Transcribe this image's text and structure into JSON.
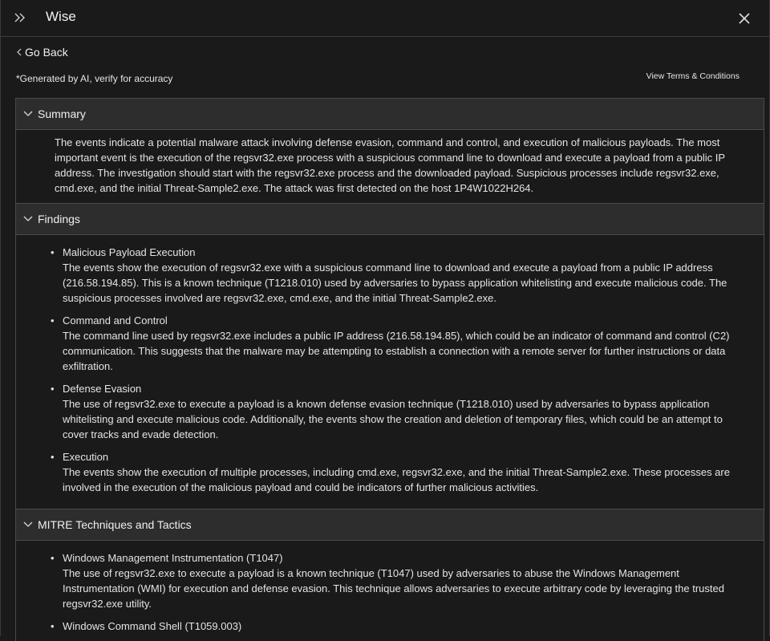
{
  "header": {
    "title": "Wise"
  },
  "nav": {
    "back_label": "Go Back"
  },
  "disclaimer": "*Generated by AI, verify for accuracy",
  "terms_link": "View Terms & Conditions",
  "sections": {
    "summary": {
      "title": "Summary",
      "text": "The events indicate a potential malware attack involving defense evasion, command and control, and execution of malicious payloads. The most important event is the execution of the regsvr32.exe process with a suspicious command line to download and execute a payload from a public IP address. The investigation should start with the regsvr32.exe process and the downloaded payload. Suspicious processes include regsvr32.exe, cmd.exe, and the initial Threat-Sample2.exe. The attack was first detected on the host 1P4W1022H264."
    },
    "findings": {
      "title": "Findings",
      "items": [
        {
          "heading": "Malicious Payload Execution",
          "text": "The events show the execution of regsvr32.exe with a suspicious command line to download and execute a payload from a public IP address (216.58.194.85). This is a known technique (T1218.010) used by adversaries to bypass application whitelisting and execute malicious code. The suspicious processes involved are regsvr32.exe, cmd.exe, and the initial Threat-Sample2.exe."
        },
        {
          "heading": "Command and Control",
          "text": "The command line used by regsvr32.exe includes a public IP address (216.58.194.85), which could be an indicator of command and control (C2) communication. This suggests that the malware may be attempting to establish a connection with a remote server for further instructions or data exfiltration."
        },
        {
          "heading": "Defense Evasion",
          "text": "The use of regsvr32.exe to execute a payload is a known defense evasion technique (T1218.010) used by adversaries to bypass application whitelisting and execute malicious code. Additionally, the events show the creation and deletion of temporary files, which could be an attempt to cover tracks and evade detection."
        },
        {
          "heading": "Execution",
          "text": "The events show the execution of multiple processes, including cmd.exe, regsvr32.exe, and the initial Threat-Sample2.exe. These processes are involved in the execution of the malicious payload and could be indicators of further malicious activities."
        }
      ]
    },
    "mitre": {
      "title": "MITRE Techniques and Tactics",
      "items": [
        {
          "heading": "Windows Management Instrumentation (T1047)",
          "text": "The use of regsvr32.exe to execute a payload is a known technique (T1047) used by adversaries to abuse the Windows Management Instrumentation (WMI) for execution and defense evasion. This technique allows adversaries to execute arbitrary code by leveraging the trusted regsvr32.exe utility."
        },
        {
          "heading": "Windows Command Shell (T1059.003)",
          "text": ""
        }
      ]
    }
  },
  "icons": {
    "expand": "double-chevron-right-icon",
    "close": "close-icon",
    "back": "chevron-left-icon",
    "section_toggle": "chevron-down-icon"
  },
  "colors": {
    "background": "#1a1a1a",
    "section_header": "#2d2d2d",
    "border": "#4a4a4a",
    "text": "#e4e4e4"
  }
}
